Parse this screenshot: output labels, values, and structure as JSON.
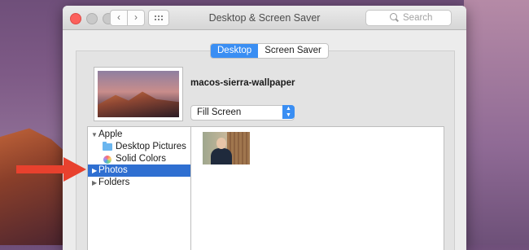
{
  "window": {
    "title": "Desktop & Screen Saver"
  },
  "search": {
    "placeholder": "Search"
  },
  "tabs": [
    {
      "label": "Desktop",
      "selected": true
    },
    {
      "label": "Screen Saver",
      "selected": false
    }
  ],
  "wallpaper": {
    "name": "macos-sierra-wallpaper"
  },
  "fit_select": {
    "value": "Fill Screen"
  },
  "sources": [
    {
      "label": "Apple",
      "type": "group",
      "expanded": true
    },
    {
      "label": "Desktop Pictures",
      "type": "folder"
    },
    {
      "label": "Solid Colors",
      "type": "colors"
    },
    {
      "label": "Photos",
      "type": "group",
      "expanded": false,
      "selected": true
    },
    {
      "label": "Folders",
      "type": "group",
      "expanded": false
    }
  ],
  "colors": {
    "accent": "#3a8ef3",
    "selection": "#2f6fd1",
    "annotation_arrow": "#e8412e",
    "close_button": "#fc605c"
  },
  "icons": [
    "close-icon",
    "minimize-icon",
    "zoom-icon",
    "back-icon",
    "forward-icon",
    "grid-icon",
    "search-icon",
    "folder-icon",
    "color-wheel-icon",
    "disclosure-triangle-icon",
    "annotation-arrow-icon"
  ]
}
